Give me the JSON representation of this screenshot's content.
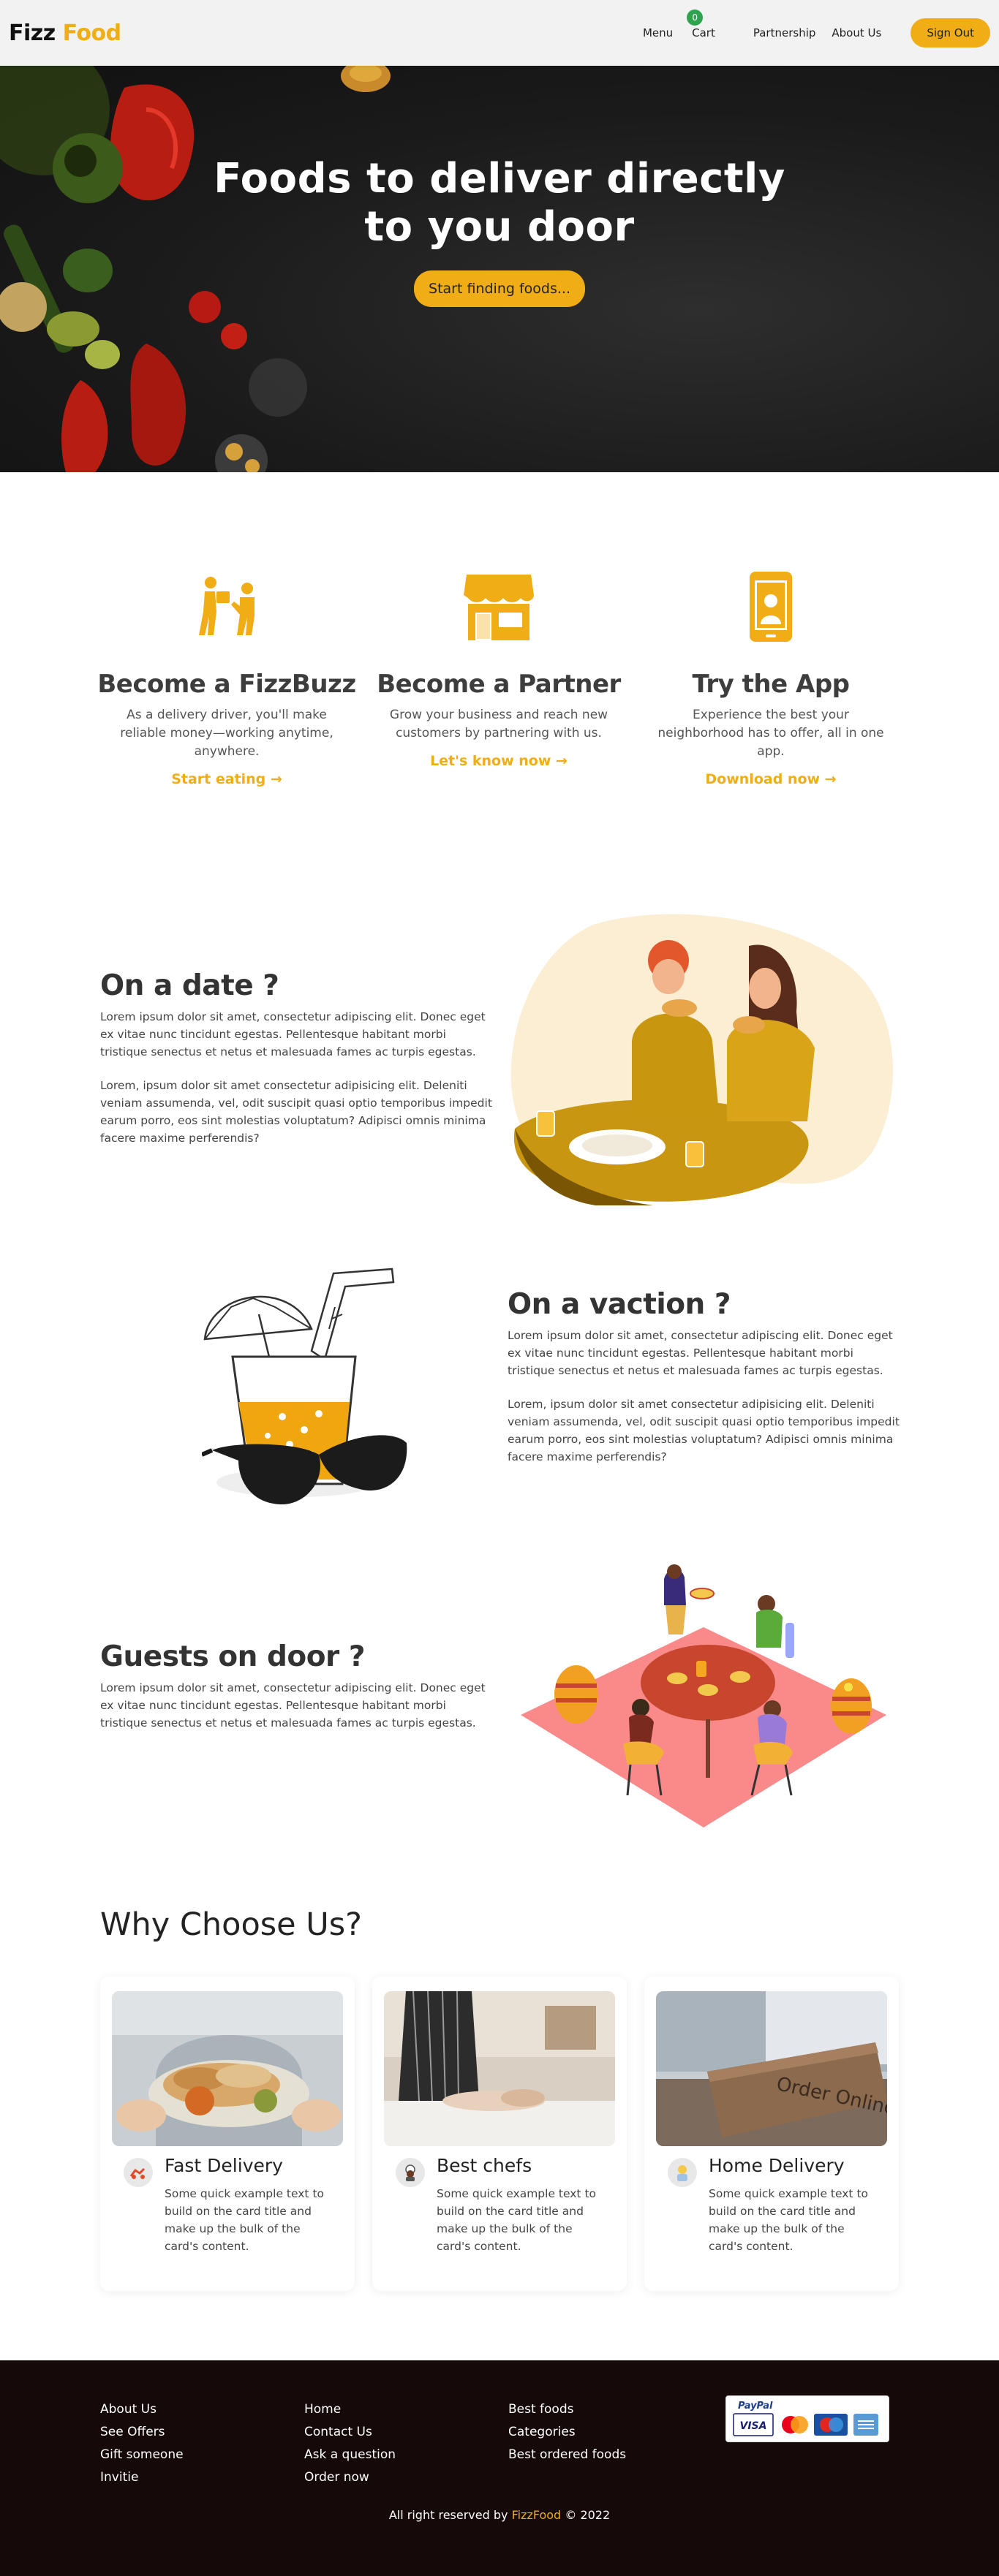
{
  "brand": {
    "part1": "Fizz",
    "part2": "Food"
  },
  "nav": {
    "menu": "Menu",
    "cart": "Cart",
    "cart_count": "0",
    "partnership": "Partnership",
    "about": "About Us",
    "signout": "Sign Out"
  },
  "hero": {
    "title_line1": "Foods to deliver directly",
    "title_line2": "to you door",
    "button": "Start finding foods..."
  },
  "features": [
    {
      "title": "Become a FizzBuzz",
      "desc": "As a delivery driver, you'll make reliable money—working anytime, anywhere.",
      "link": "Start eating →",
      "icon": "delivery-people-icon"
    },
    {
      "title": "Become a Partner",
      "desc": "Grow your business and reach new customers by partnering with us.",
      "link": "Let's know now →",
      "icon": "store-icon"
    },
    {
      "title": "Try the App",
      "desc": "Experience the best your neighborhood has to offer, all in one app.",
      "link": "Download now →",
      "icon": "smartphone-icon"
    }
  ],
  "sections": {
    "date": {
      "title": "On a date ?",
      "p1": "Lorem ipsum dolor sit amet, consectetur adipiscing elit. Donec eget ex vitae nunc tincidunt egestas. Pellentesque habitant morbi tristique senectus et netus et malesuada fames ac turpis egestas.",
      "p2": "Lorem, ipsum dolor sit amet consectetur adipisicing elit. Deleniti veniam assumenda, vel, odit suscipit quasi optio temporibus impedit earum porro, eos sint molestias voluptatum? Adipisci omnis minima facere maxime perferendis?"
    },
    "vacation": {
      "title": "On a vaction ?",
      "p1": "Lorem ipsum dolor sit amet, consectetur adipiscing elit. Donec eget ex vitae nunc tincidunt egestas. Pellentesque habitant morbi tristique senectus et netus et malesuada fames ac turpis egestas.",
      "p2": "Lorem, ipsum dolor sit amet consectetur adipisicing elit. Deleniti veniam assumenda, vel, odit suscipit quasi optio temporibus impedit earum porro, eos sint molestias voluptatum? Adipisci omnis minima facere maxime perferendis?"
    },
    "guests": {
      "title": "Guests on door ?",
      "p1": "Lorem ipsum dolor sit amet, consectetur adipiscing elit. Donec eget ex vitae nunc tincidunt egestas. Pellentesque habitant morbi tristique senectus et netus et malesuada fames ac turpis egestas."
    }
  },
  "why": {
    "title": "Why Choose Us?",
    "cards": [
      {
        "title": "Fast Delivery",
        "text": "Some quick example text to build on the card title and make up the bulk of the card's content."
      },
      {
        "title": "Best chefs",
        "text": "Some quick example text to build on the card title and make up the bulk of the card's content."
      },
      {
        "title": "Home Delivery",
        "text": "Some quick example text to build on the card title and make up the bulk of the card's content."
      }
    ],
    "box_text": "Order Online"
  },
  "footer": {
    "col1": [
      "About Us",
      "See Offers",
      "Gift someone",
      "Invitie"
    ],
    "col2": [
      "Home",
      "Contact Us",
      "Ask a question",
      "Order now"
    ],
    "col3": [
      "Best foods",
      "Categories",
      "Best ordered foods"
    ],
    "paypal_logo": "PayPal",
    "card_logos": [
      "VISA",
      "MasterCard",
      "Maestro"
    ],
    "copyright_prefix": "All right reserved by",
    "copyright_brand": "FizzFood",
    "copyright_suffix": "© 2022"
  },
  "colors": {
    "accent": "#f0ad15",
    "footer_bg": "#150909",
    "badge": "#2fa44f"
  }
}
